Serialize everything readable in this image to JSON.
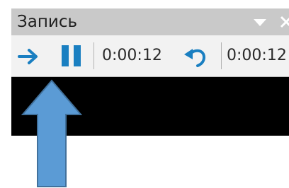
{
  "window": {
    "title": "Запись"
  },
  "toolbar": {
    "elapsed_time": "0:00:12",
    "clip_time": "0:00:12"
  },
  "icons": {
    "dropdown": "chevron-down-icon",
    "close": "close-icon",
    "next": "arrow-right-icon",
    "pause": "pause-icon",
    "undo": "undo-icon"
  },
  "colors": {
    "accent_blue": "#1a7fc1",
    "title_bar": "#c9c9c9",
    "toolbar_bg": "#f2f2f2",
    "callout_fill": "#5b9bd5",
    "callout_stroke": "#41719c"
  }
}
